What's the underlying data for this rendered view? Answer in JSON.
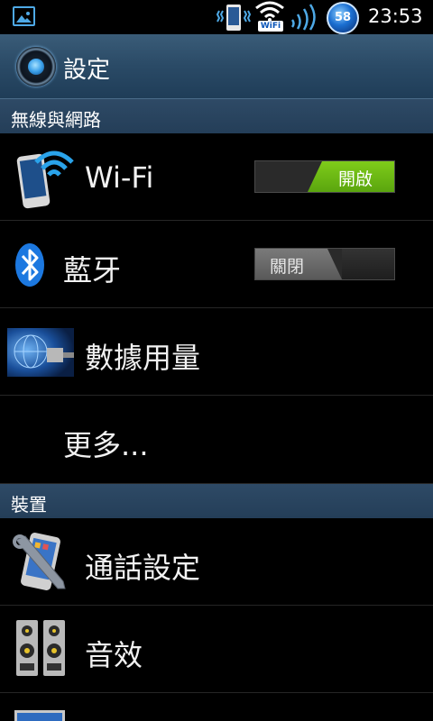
{
  "status_bar": {
    "time": "23:53",
    "battery_level": "58",
    "wifi_tag": "WiFi",
    "icons": [
      "gallery-icon",
      "phone-vibrate-icon",
      "wifi-icon",
      "signal-icon",
      "battery-icon"
    ]
  },
  "title_bar": {
    "title": "設定",
    "icon": "settings-icon"
  },
  "sections": [
    {
      "label": "無線與網路"
    },
    {
      "label": "裝置"
    }
  ],
  "items": [
    {
      "label": "Wi-Fi",
      "icon": "wifi-phone-icon",
      "toggle": {
        "state": "on",
        "label": "開啟"
      }
    },
    {
      "label": "藍牙",
      "icon": "bluetooth-icon",
      "toggle": {
        "state": "off",
        "label": "關閉"
      }
    },
    {
      "label": "數據用量",
      "icon": "data-usage-icon"
    },
    {
      "label": "更多..."
    },
    {
      "label": "通話設定",
      "icon": "call-settings-icon"
    },
    {
      "label": "音效",
      "icon": "speaker-icon"
    }
  ],
  "colors": {
    "accent_green": "#7fcc1a",
    "header_blue": "#2a4a66",
    "background": "#000000"
  }
}
